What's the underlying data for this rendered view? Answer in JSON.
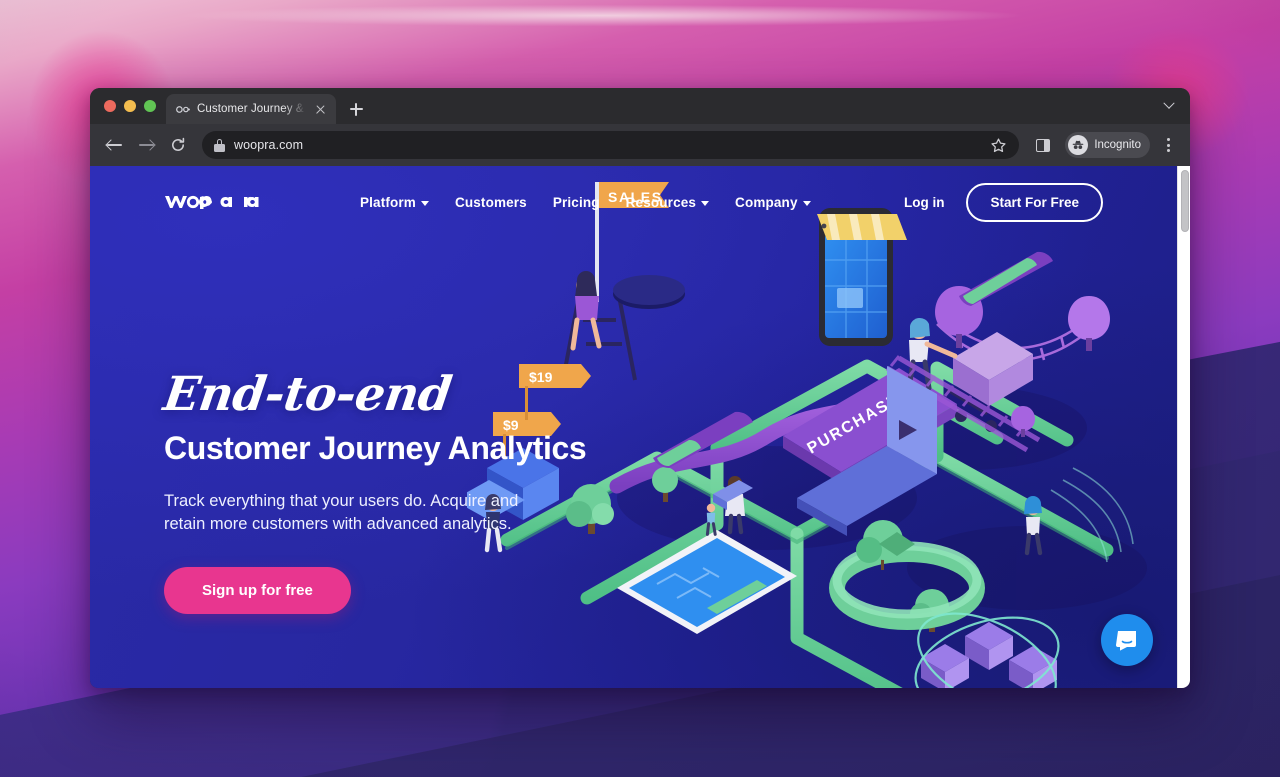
{
  "desktop": {
    "wallpaper_name": "macos-monterey-pink-purple-wallpaper"
  },
  "browser": {
    "traffic_lights": {
      "close": "close-window",
      "minimize": "minimize-window",
      "zoom": "zoom-window"
    },
    "tab": {
      "title": "Customer Journey & Product A",
      "favicon": "woopra-favicon",
      "close_label": "×"
    },
    "new_tab_label": "+",
    "tab_list_chevron": "chevron-down-icon",
    "toolbar": {
      "back": "back-arrow-icon",
      "forward": "forward-arrow-icon",
      "reload": "reload-icon",
      "lock": "lock-icon",
      "url": "woopra.com",
      "bookmark": "star-icon",
      "side_panel": "side-panel-icon",
      "incognito_label": "Incognito",
      "menu": "three-dot-menu-icon"
    }
  },
  "site": {
    "logo_text": "woopra",
    "nav": [
      {
        "label": "Platform",
        "has_dropdown": true
      },
      {
        "label": "Customers",
        "has_dropdown": false
      },
      {
        "label": "Pricing",
        "has_dropdown": false
      },
      {
        "label": "Resources",
        "has_dropdown": true
      },
      {
        "label": "Company",
        "has_dropdown": true
      }
    ],
    "login_label": "Log in",
    "header_cta_label": "Start For Free",
    "hero": {
      "script_line": "End-to-end",
      "title": "Customer Journey Analytics",
      "subtitle": "Track everything that your users do. Acquire and retain more customers with advanced analytics.",
      "cta_label": "Sign up for free"
    },
    "illustration": {
      "name": "isometric-customer-journey-illustration",
      "labels": {
        "sales_flag": "SALES",
        "purchase_banner": "PURCHASE",
        "price_tag_1": "$19",
        "price_tag_2": "$9"
      }
    },
    "chat_widget": {
      "name": "intercom-chat-launcher"
    }
  },
  "colors": {
    "brand_blue": "#2727a0",
    "brand_pink": "#e8368f",
    "accent_green": "#6ecf9a",
    "accent_purple": "#9b57d6",
    "accent_orange": "#f0a64b",
    "chat_blue": "#1f8ded"
  }
}
